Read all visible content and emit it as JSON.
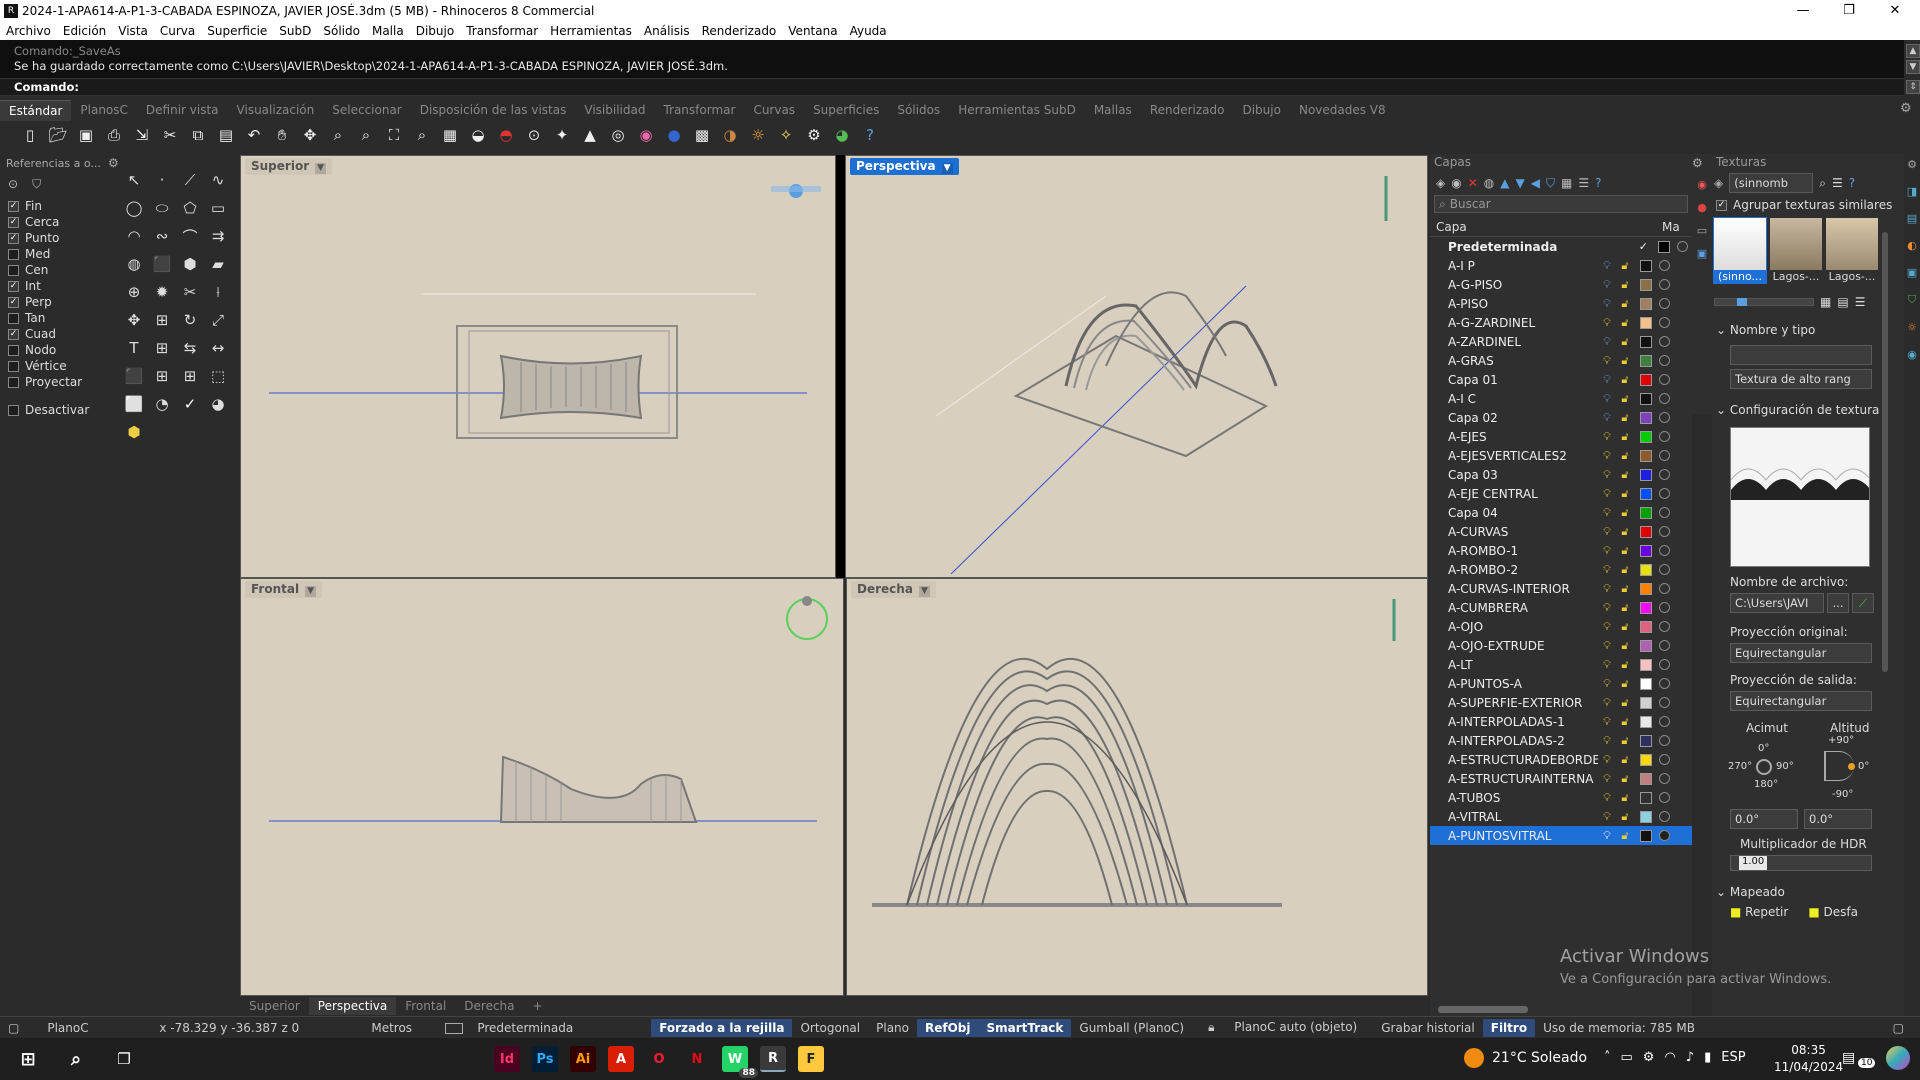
{
  "window": {
    "title": "2024-1-APA614-A-P1-3-CABADA ESPINOZA, JAVIER JOSÉ.3dm (5 MB) - Rhinoceros 8 Commercial",
    "minimize": "—",
    "maximize": "❐",
    "close": "✕"
  },
  "menu": [
    "Archivo",
    "Edición",
    "Vista",
    "Curva",
    "Superficie",
    "SubD",
    "Sólido",
    "Malla",
    "Dibujo",
    "Transformar",
    "Herramientas",
    "Análisis",
    "Renderizado",
    "Ventana",
    "Ayuda"
  ],
  "command": {
    "history_faded": "Comando:_SaveAs",
    "history": "Se ha guardado correctamente como C:\\Users\\JAVIER\\Desktop\\2024-1-APA614-A-P1-3-CABADA ESPINOZA, JAVIER JOSÉ.3dm.",
    "prompt": "Comando:"
  },
  "toolbar_tabs": [
    "Estándar",
    "PlanosC",
    "Definir vista",
    "Visualización",
    "Seleccionar",
    "Disposición de las vistas",
    "Visibilidad",
    "Transformar",
    "Curvas",
    "Superficies",
    "Sólidos",
    "Herramientas SubD",
    "Mallas",
    "Renderizado",
    "Dibujo",
    "Novedades V8"
  ],
  "toolbar_icons": [
    "new-icon",
    "open-icon",
    "save-icon",
    "print-icon",
    "import-icon",
    "cut-icon",
    "copy-icon",
    "paste-icon",
    "undo-icon",
    "pan-icon",
    "rotate-view-icon",
    "zoom-icon",
    "zoom-window-icon",
    "zoom-extents-icon",
    "zoom-selected-icon",
    "layouts-icon",
    "show-object-icon",
    "car-icon",
    "point-on-icon",
    "light-icon",
    "lock-icon",
    "osnap-icon",
    "color-wheel-icon",
    "render-sphere-icon",
    "grid-icon",
    "material-icon",
    "sun-icon",
    "light-bulb-icon",
    "options-icon",
    "render-icon",
    "help-icon"
  ],
  "osnap": {
    "header": "Referencias a o...",
    "items": [
      {
        "label": "Fin",
        "checked": true
      },
      {
        "label": "Cerca",
        "checked": true
      },
      {
        "label": "Punto",
        "checked": true
      },
      {
        "label": "Med",
        "checked": false
      },
      {
        "label": "Cen",
        "checked": false
      },
      {
        "label": "Int",
        "checked": true
      },
      {
        "label": "Perp",
        "checked": true
      },
      {
        "label": "Tan",
        "checked": false
      },
      {
        "label": "Cuad",
        "checked": true
      },
      {
        "label": "Nodo",
        "checked": false
      },
      {
        "label": "Vértice",
        "checked": false
      },
      {
        "label": "Proyectar",
        "checked": false
      }
    ],
    "disable": "Desactivar"
  },
  "viewports": {
    "top": "Superior",
    "perspective": "Perspectiva",
    "front": "Frontal",
    "right": "Derecha"
  },
  "viewport_tabs": [
    "Superior",
    "Perspectiva",
    "Frontal",
    "Derecha",
    "+"
  ],
  "layers": {
    "title": "Capas",
    "search_placeholder": "Buscar",
    "col_name": "Capa",
    "col_mat": "Ma",
    "rows": [
      {
        "name": "Predeterminada",
        "color": "#000000",
        "bold": true
      },
      {
        "name": "A-I P",
        "color": "#111111"
      },
      {
        "name": "A-G-PISO",
        "color": "#8b6f47"
      },
      {
        "name": "A-PISO",
        "color": "#a08060"
      },
      {
        "name": "A-G-ZARDINEL",
        "color": "#f4c08a"
      },
      {
        "name": "A-ZARDINEL",
        "color": "#111111"
      },
      {
        "name": "A-GRAS",
        "color": "#3f7f3f"
      },
      {
        "name": "Capa 01",
        "color": "#e00000"
      },
      {
        "name": "A-I C",
        "color": "#111111"
      },
      {
        "name": "Capa 02",
        "color": "#7f3fbf"
      },
      {
        "name": "A-EJES",
        "color": "#00cc00"
      },
      {
        "name": "A-EJESVERTICALES2",
        "color": "#8b5a2b"
      },
      {
        "name": "Capa 03",
        "color": "#1f1fe0"
      },
      {
        "name": "A-EJE CENTRAL",
        "color": "#0050ff"
      },
      {
        "name": "Capa 04",
        "color": "#00a000"
      },
      {
        "name": "A-CURVAS",
        "color": "#e00000"
      },
      {
        "name": "A-ROMBO-1",
        "color": "#6a00e0"
      },
      {
        "name": "A-ROMBO-2",
        "color": "#e8e000"
      },
      {
        "name": "A-CURVAS-INTERIOR",
        "color": "#ff8000"
      },
      {
        "name": "A-CUMBRERA",
        "color": "#ff00ff"
      },
      {
        "name": "A-OJO",
        "color": "#e06080"
      },
      {
        "name": "A-OJO-EXTRUDE",
        "color": "#b060b0"
      },
      {
        "name": "A-LT",
        "color": "#ffc0c0"
      },
      {
        "name": "A-PUNTOS-A",
        "color": "#ffffff"
      },
      {
        "name": "A-SUPERFIE-EXTERIOR",
        "color": "#d0d0d0"
      },
      {
        "name": "A-INTERPOLADAS-1",
        "color": "#e8e8e8"
      },
      {
        "name": "A-INTERPOLADAS-2",
        "color": "#303060"
      },
      {
        "name": "A-ESTRUCTURADEBORDE",
        "color": "#ffd800"
      },
      {
        "name": "A-ESTRUCTURAINTERNA",
        "color": "#c08080"
      },
      {
        "name": "A-TUBOS",
        "color": "#303030"
      },
      {
        "name": "A-VITRAL",
        "color": "#8fd0e0"
      },
      {
        "name": "A-PUNTOSVITRAL",
        "color": "#111111",
        "selected": true
      }
    ]
  },
  "textures": {
    "title": "Texturas",
    "dropdown": "(sinnomb",
    "group_similar": "Agrupar texturas similares",
    "thumbs": [
      "(sinno...",
      "Lagos-...",
      "Lagos-..."
    ],
    "section_name": "Nombre y tipo",
    "type_value": "Textura de alto rang",
    "section_config": "Configuración de textura",
    "filename_label": "Nombre de archivo:",
    "filename_value": "C:\\Users\\JAVI",
    "filename_btn": "...",
    "proj_orig_label": "Proyección original:",
    "proj_orig_value": "Equirectangular",
    "proj_out_label": "Proyección de salida:",
    "proj_out_value": "Equirectangular",
    "azimuth_label": "Acimut",
    "altitude_label": "Altitud",
    "az_0": "0°",
    "az_90": "90°",
    "az_180": "180°",
    "az_270": "270°",
    "alt_p90": "+90°",
    "alt_0": "0°",
    "alt_m90": "-90°",
    "azimuth_value": "0.0°",
    "altitude_value": "0.0°",
    "hdr_label": "Multiplicador de HDR",
    "hdr_value": "1.00",
    "section_mapping": "Mapeado",
    "repeat": "Repetir",
    "offset": "Desfa"
  },
  "watermark": {
    "line1": "Activar Windows",
    "line2": "Ve a Configuración para activar Windows."
  },
  "status": {
    "cplane": "PlanoC",
    "coords": "x -78.329   y -36.387   z 0",
    "units": "Metros",
    "layer": "Predeterminada",
    "grid_snap": "Forzado a la rejilla",
    "ortho": "Ortogonal",
    "planar": "Plano",
    "osnap": "RefObj",
    "smarttrack": "SmartTrack",
    "gumball": "Gumball (PlanoC)",
    "autocplane": "PlanoC auto (objeto)",
    "history": "Grabar historial",
    "filter": "Filtro",
    "memory": "Uso de memoria: 785 MB"
  },
  "taskbar": {
    "apps": [
      "Id",
      "Ps",
      "Ai",
      "A",
      "O",
      "N",
      "W",
      "R",
      "F"
    ],
    "whatsapp_badge": "88",
    "weather": "21°C  Soleado",
    "lang": "ESP",
    "time": "08:35",
    "date": "11/04/2024",
    "notif": "10"
  },
  "colors": {
    "accent": "#1e6fd6",
    "viewport_bg": "#d8cfbf",
    "panel": "#2f2f2f"
  }
}
